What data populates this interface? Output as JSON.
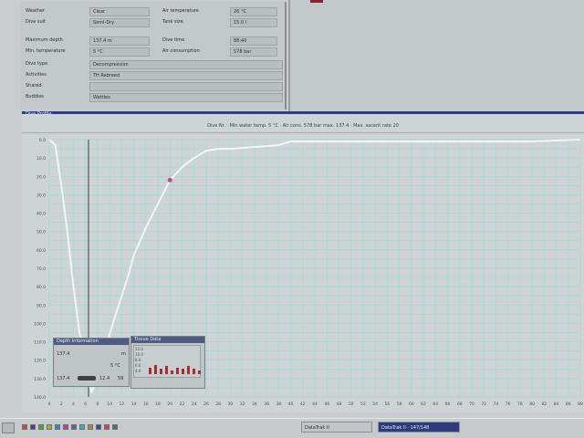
{
  "info": {
    "rows_left": [
      {
        "label": "Weather",
        "value": "Clear"
      },
      {
        "label": "Dive suit",
        "value": "Semi-Dry"
      },
      {
        "label": "Maximum depth",
        "value": "137.4 m"
      },
      {
        "label": "Min. temperature",
        "value": "5 °C"
      },
      {
        "label": "Dive type",
        "value": "Decompression"
      },
      {
        "label": "Activities",
        "value": "TH Rebreed"
      },
      {
        "label": "Shared",
        "value": ""
      },
      {
        "label": "Buddies",
        "value": "Wattles"
      }
    ],
    "rows_right": [
      {
        "label": "Air temperature",
        "value": "26 °C"
      },
      {
        "label": "Tank size",
        "value": "15.0 l"
      },
      {
        "label": "Dive time",
        "value": "88:40"
      },
      {
        "label": "Air consumption",
        "value": "578 bar"
      }
    ]
  },
  "dive_window": {
    "title": "Dive Profile",
    "header": "Dive Nr. · Min water temp. 5 °C · Air cons. 578 bar max. 137.4 · Max. ascent rate 20"
  },
  "chart_data": {
    "type": "line",
    "title": "",
    "xlabel": "",
    "ylabel": "",
    "x_ticks": [
      "0",
      "2",
      "4",
      "6",
      "8",
      "10",
      "12",
      "14",
      "16",
      "18",
      "20",
      "22",
      "24",
      "26",
      "28",
      "30",
      "32",
      "34",
      "36",
      "38",
      "40",
      "42",
      "44",
      "46",
      "48",
      "50",
      "52",
      "54",
      "56",
      "58",
      "60",
      "62",
      "64",
      "66",
      "68",
      "70",
      "72",
      "74",
      "76",
      "78",
      "80",
      "82",
      "84",
      "86",
      "88"
    ],
    "y_ticks": [
      "0.0",
      "10.0",
      "20.0",
      "30.0",
      "40.0",
      "50.0",
      "60.0",
      "70.0",
      "80.0",
      "90.0",
      "100.0",
      "110.0",
      "120.0",
      "130.0",
      "140.0"
    ],
    "xlim": [
      0,
      88
    ],
    "ylim": [
      0,
      140
    ],
    "series": [
      {
        "x": [
          0,
          1,
          2,
          3,
          4,
          5,
          6,
          7,
          8,
          9,
          10,
          11,
          12,
          13,
          14,
          16,
          18,
          20,
          22,
          24,
          26,
          28,
          30,
          34,
          38,
          40,
          45,
          50,
          55,
          60,
          70,
          80,
          88
        ],
        "y": [
          0,
          3,
          25,
          50,
          80,
          105,
          125,
          137.4,
          130,
          118,
          106,
          95,
          85,
          75,
          63,
          48,
          35,
          22,
          15,
          10,
          6,
          5,
          5,
          4,
          3,
          1,
          1,
          1,
          1,
          1,
          1,
          1,
          0
        ],
        "color": "#f2f4f6"
      }
    ],
    "cursor_x": 6.5,
    "marker": {
      "x": 20,
      "y": 22,
      "color": "#c04a8a"
    },
    "grid": true,
    "colors": {
      "grid": "#7fe4d8",
      "line": "#f2f4f6",
      "background": "#ced3d5"
    }
  },
  "depth_window": {
    "title": "Depth Information",
    "line1_value": "137.4",
    "line1_unit": "m",
    "line2": "5 °C",
    "line3_a": "137.4",
    "line3_b": "12.4",
    "line3_c": "59"
  },
  "tissue_window": {
    "title": "Tissue Data",
    "labels": [
      "12.0",
      "10.0",
      "8.0",
      "6.0",
      "4.0"
    ],
    "bars": [
      0.25,
      0.35,
      0.2,
      0.3,
      0.15,
      0.25,
      0.2,
      0.3,
      0.2,
      0.15
    ]
  },
  "taskbar": {
    "tasks": [
      {
        "label": "DataTrak II",
        "active": false
      },
      {
        "label": "DataTrak II · 147/148",
        "active": true
      }
    ]
  }
}
